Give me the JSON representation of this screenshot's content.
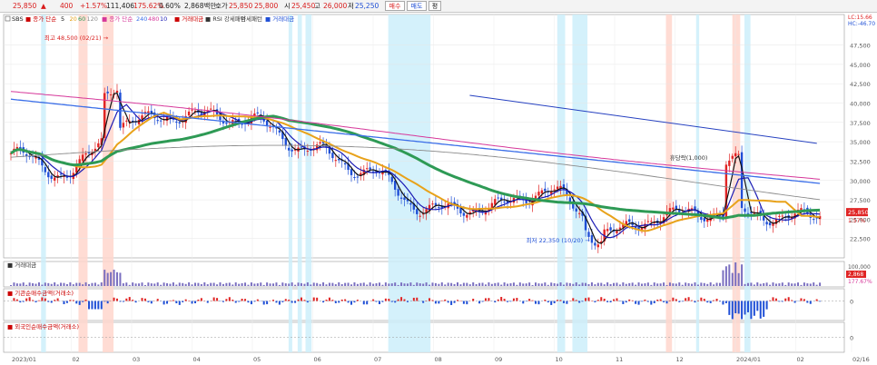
{
  "toolbar": {
    "price": "25,850",
    "change": "400",
    "change_pct": "+1.57%",
    "volume": "111,406",
    "vol_ratio": "175.62%",
    "turnover": "0.60%",
    "trade_value": "2,868백만",
    "quote_label": "호가",
    "ask": "25,850",
    "bid": "25,800",
    "open_label": "시",
    "open": "25,450",
    "high_label": "고",
    "high": "26,000",
    "low_label": "저",
    "low": "25,250",
    "buttons": [
      "매수",
      "매도",
      "평"
    ]
  },
  "legend": {
    "ticker": "SBS",
    "ma_price_label": "종가 단순",
    "ma_price_periods": [
      "5",
      "20",
      "60",
      "120"
    ],
    "ma_vol_label": "종가 단순",
    "ma_vol_periods": [
      "240",
      "480",
      "10"
    ],
    "volume_label": "거래대금",
    "rsi_label": "RSI 강세패턴",
    "rsi_label2": "약세패턴",
    "value_label": "거래대금"
  },
  "colors": {
    "up": "#e02424",
    "down": "#1f4fd6",
    "ma5": "#111111",
    "ma20": "#1b1bb5",
    "ma60": "#e8a21a",
    "ma120": "#2e9a55",
    "ma240": "#3a6ee8",
    "ma480": "#d6389a",
    "ma_gray": "#8c8c8c",
    "trend": "#2540c0",
    "bull_band": "#ffd6cc",
    "bear_band": "#cdeefa"
  },
  "chart_data": {
    "type": "candlestick",
    "title": "SBS",
    "x_tick_labels": [
      "2023/01",
      "02",
      "03",
      "04",
      "05",
      "06",
      "07",
      "08",
      "09",
      "10",
      "11",
      "12",
      "2024/01",
      "02",
      "02/16"
    ],
    "y_ticks": [
      22500,
      25000,
      27500,
      30000,
      32500,
      35000,
      37500,
      40000,
      42500,
      45000,
      47500
    ],
    "y_tick_labels": [
      "22,500",
      "25,000",
      "27,500",
      "30,000",
      "32,500",
      "35,000",
      "37,500",
      "40,000",
      "42,500",
      "45,000",
      "47,500"
    ],
    "ylim": [
      20000,
      50500
    ],
    "last_price": 25850,
    "last_price_label": "25,850",
    "last_change_label": "1.57%",
    "corner_labels": [
      "LC:15.66",
      "HC:-46.70"
    ],
    "annotations": [
      {
        "text": "최고 48,500 (02/21)",
        "value": 48500,
        "month": 1.67,
        "arrow": "→"
      },
      {
        "text": "최저 22,350 (10/20)",
        "value": 22350,
        "month": 9.65,
        "arrow": "→"
      },
      {
        "text": "휴당락(1,000)",
        "value": 33000,
        "month": 11.6,
        "arrow": "←"
      }
    ],
    "monthly_close": [
      {
        "month": "2023/01",
        "close": 30800
      },
      {
        "month": "2023/02",
        "close": 37500
      },
      {
        "month": "2023/03",
        "close": 38500
      },
      {
        "month": "2023/04",
        "close": 38000
      },
      {
        "month": "2023/05",
        "close": 34200
      },
      {
        "month": "2023/06",
        "close": 31200
      },
      {
        "month": "2023/07",
        "close": 26200
      },
      {
        "month": "2023/08",
        "close": 26500
      },
      {
        "month": "2023/09",
        "close": 28700
      },
      {
        "month": "2023/10",
        "close": 23200
      },
      {
        "month": "2023/11",
        "close": 25600
      },
      {
        "month": "2023/12",
        "close": 25900
      },
      {
        "month": "2024/01",
        "close": 25200
      },
      {
        "month": "2024/02",
        "close": 25850
      }
    ],
    "trend_line": {
      "start": {
        "month": 7.6,
        "value": 41000
      },
      "end": {
        "month": 13.35,
        "value": 34800
      }
    },
    "bull_bands_months": [
      [
        1.12,
        1.27
      ],
      [
        1.52,
        1.7
      ],
      [
        10.85,
        10.95
      ],
      [
        11.95,
        12.08
      ]
    ],
    "bear_bands_months": [
      [
        0.5,
        0.58
      ],
      [
        4.6,
        4.66
      ],
      [
        4.75,
        4.82
      ],
      [
        4.88,
        4.98
      ],
      [
        6.25,
        6.95
      ],
      [
        9.05,
        9.18
      ],
      [
        9.3,
        9.55
      ],
      [
        11.35,
        11.4
      ],
      [
        12.15,
        12.25
      ]
    ],
    "volume_panel": {
      "title": "거래대금",
      "axis_labels": [
        "100,000",
        "2,868"
      ],
      "ratio_label": "177.67%",
      "peak_month": 11.95
    },
    "inst_panel": {
      "title": "기관순매수금액(거래소)",
      "axis_label": "0"
    },
    "foreign_panel": {
      "title": "외국인순매수금액(거래소)",
      "axis_label": "0"
    }
  }
}
